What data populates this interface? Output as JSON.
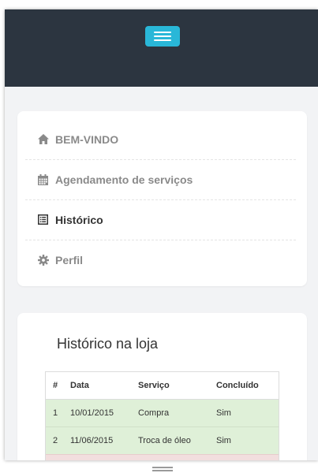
{
  "colors": {
    "topbar": "#2c3540",
    "toggle": "#29b7d8",
    "success_row": "#dff0d8",
    "danger_row": "#f2dede"
  },
  "navbar": {
    "toggle_icon": "hamburger-menu-icon"
  },
  "menu": {
    "items": [
      {
        "label": "BEM-VINDO",
        "icon": "home-icon",
        "active": false
      },
      {
        "label": "Agendamento de serviços",
        "icon": "calendar-icon",
        "active": false
      },
      {
        "label": "Histórico",
        "icon": "list-icon",
        "active": true
      },
      {
        "label": "Perfil",
        "icon": "gear-icon",
        "active": false
      }
    ]
  },
  "history": {
    "title": "Histórico na loja",
    "columns": [
      "#",
      "Data",
      "Serviço",
      "Concluído"
    ],
    "rows": [
      {
        "status": "success",
        "cells": [
          "1",
          "10/01/2015",
          "Compra",
          "Sim"
        ]
      },
      {
        "status": "success",
        "cells": [
          "2",
          "11/06/2015",
          "Troca de óleo",
          "Sim"
        ]
      },
      {
        "status": "danger",
        "cells": [
          "",
          "",
          "",
          ""
        ]
      }
    ]
  }
}
